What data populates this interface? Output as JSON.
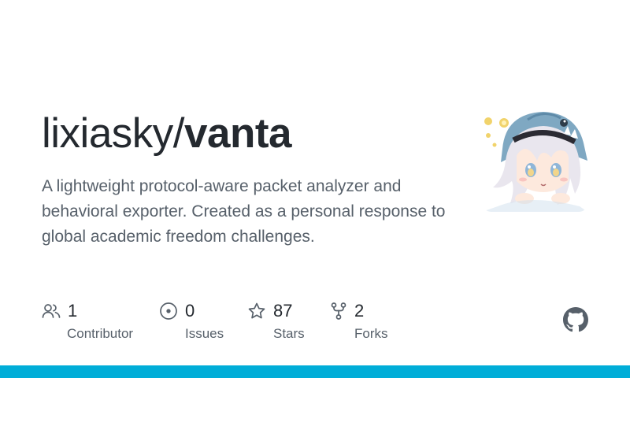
{
  "repo": {
    "owner": "lixiasky/",
    "name": "vanta",
    "description": "A lightweight protocol-aware packet analyzer and behavioral exporter. Created as a personal response to global academic freedom challenges."
  },
  "avatar": {
    "icon": "anime-girl-shark-hood-avatar"
  },
  "stats": [
    {
      "icon": "contributors-icon",
      "value": "1",
      "label": "Contributor"
    },
    {
      "icon": "issues-icon",
      "value": "0",
      "label": "Issues"
    },
    {
      "icon": "star-icon",
      "value": "87",
      "label": "Stars"
    },
    {
      "icon": "fork-icon",
      "value": "2",
      "label": "Forks"
    }
  ],
  "brand": {
    "icon": "github-mark-icon"
  },
  "colors": {
    "text": "#24292f",
    "muted": "#57606a",
    "accent_bar": "#00add8"
  }
}
